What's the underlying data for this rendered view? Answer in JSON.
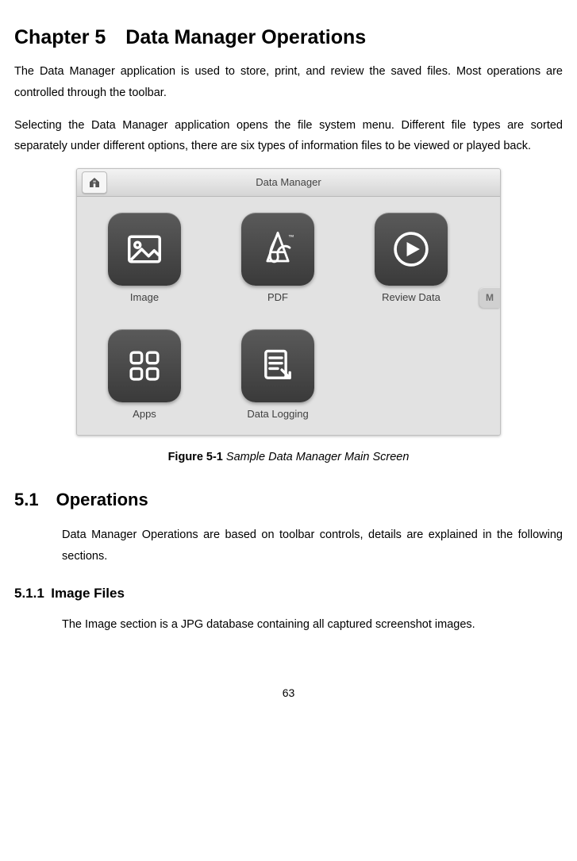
{
  "chapter_title": "Chapter 5 Data Manager Operations",
  "para1": "The Data Manager application is used to store, print, and review the saved files. Most operations are controlled through the toolbar.",
  "para2": "Selecting the Data Manager application opens the file system menu. Different file types are sorted separately under different options, there are six types of information files to be viewed or played back.",
  "screenshot": {
    "header_title": "Data Manager",
    "tiles": {
      "image": "Image",
      "pdf": "PDF",
      "review_data": "Review Data",
      "apps": "Apps",
      "data_logging": "Data Logging"
    },
    "side_tab": "M"
  },
  "figure": {
    "label": "Figure 5-1",
    "text": " Sample Data Manager Main Screen"
  },
  "section_5_1_title": "5.1 Operations",
  "section_5_1_para": "Data Manager Operations are based on toolbar controls, details are explained in the following sections.",
  "section_5_1_1_title": "5.1.1 Image Files",
  "section_5_1_1_para": "The Image section is a JPG database containing all captured screenshot images.",
  "page_number": "63"
}
